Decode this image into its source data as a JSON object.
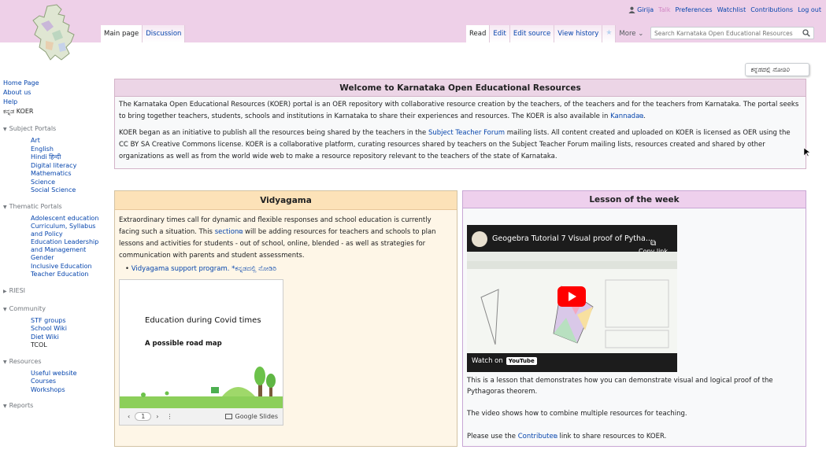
{
  "personal": {
    "user": "Girija",
    "talk": "Talk",
    "preferences": "Preferences",
    "watchlist": "Watchlist",
    "contributions": "Contributions",
    "logout": "Log out"
  },
  "tabs_left": [
    "Main page",
    "Discussion"
  ],
  "tabs_right": {
    "read": "Read",
    "edit": "Edit",
    "edit_source": "Edit source",
    "view_history": "View history",
    "more": "More"
  },
  "search": {
    "placeholder": "Search Karnataka Open Educational Resources"
  },
  "sidebar": {
    "links": [
      "Home Page",
      "About us",
      "Help",
      "ಕನ್ನಡ KOER"
    ],
    "portals": [
      {
        "title": "Subject Portals",
        "items": [
          "Art",
          "English",
          "Hindi हिन्दी",
          "Digital literacy",
          "Mathematics",
          "Science",
          "Social Science"
        ]
      },
      {
        "title": "Thematic Portals",
        "items": [
          "Adolescent education",
          "Curriculum, Syllabus and Policy",
          "Education Leadership and Management",
          "Gender",
          "Inclusive Education",
          "Teacher Education"
        ]
      },
      {
        "title": "RIESI",
        "items": []
      },
      {
        "title": "Community",
        "items": [
          "STF groups",
          "School Wiki",
          "Diet Wiki",
          "TCOL"
        ]
      },
      {
        "title": "Resources",
        "items": [
          "Useful website",
          "Courses",
          "Workshops"
        ]
      },
      {
        "title": "Reports",
        "items": []
      }
    ]
  },
  "lang_button": "ಕನ್ನಡದಲ್ಲಿ ನೋಡಿರಿ",
  "welcome": {
    "title": "Welcome to Karnataka Open Educational Resources",
    "p1_a": "The Karnataka Open Educational Resources (KOER) portal is an OER repository with collaborative resource creation by the teachers, of the teachers and for the teachers from Karnataka. The portal seeks to bring together teachers, students, schools and institutions in Karnataka to share their experiences and resources. The KOER is also available in ",
    "p1_link": "Kannada",
    "p1_b": ".",
    "p2_a": "KOER began as an initiative to publish all the resources being shared by the teachers in the ",
    "p2_link": "Subject Teacher Forum",
    "p2_b": " mailing lists. All content created and uploaded on KOER is licensed as OER using the CC BY SA Creative Commons license. KOER is a collaborative platform, curating resources shared by teachers on the Subject Teacher Forum mailing lists, resources created and shared by other organizations as well as from the world wide web to make a resource repository relevant to the teachers of the state of Karnataka."
  },
  "vidyagama": {
    "title": "Vidyagama",
    "p_a": "Extraordinary times call for dynamic and flexible responses and school education is currently facing such a situation. This ",
    "p_link": "section",
    "p_b": " will be adding resources for teachers and schools to plan lessons and activities for students - out of school, online, blended - as well as strategies for communication with parents and student assessments.",
    "bullet_link": "Vidyagama support program.",
    "bullet_kn": "*ಕನ್ನಡದಲ್ಲಿ ನೋಡಿರಿ",
    "slide_title": "Education during Covid times",
    "slide_sub": "A possible road map",
    "slide_page": "1",
    "slide_label": "Google Slides"
  },
  "lesson": {
    "title": "Lesson of the week",
    "video_title": "Geogebra Tutorial 7 Visual proof of Pytha...",
    "copy_link": "Copy link",
    "watch_on": "Watch on",
    "youtube": "YouTube",
    "p1": "This is a lesson that demonstrates how you can demonstrate visual and logical proof of the Pythagoras theorem.",
    "p2": "The video shows how to combine multiple resources for teaching.",
    "p3_a": "Please use the ",
    "p3_link": "Contribute",
    "p3_b": " link to share resources to KOER."
  }
}
